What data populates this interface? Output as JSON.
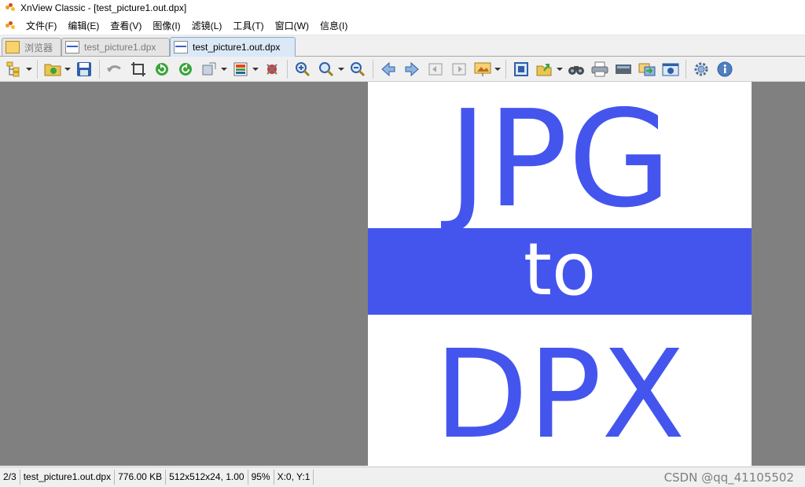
{
  "window": {
    "title": "XnView Classic - [test_picture1.out.dpx]"
  },
  "menu": {
    "items": [
      "文件(F)",
      "编辑(E)",
      "查看(V)",
      "图像(I)",
      "滤镜(L)",
      "工具(T)",
      "窗口(W)",
      "信息(I)"
    ]
  },
  "tabs": [
    {
      "label": "浏览器",
      "active": false
    },
    {
      "label": "test_picture1.dpx",
      "active": false
    },
    {
      "label": "test_picture1.out.dpx",
      "active": true
    }
  ],
  "toolbar": {
    "buttons": [
      "tree-icon",
      "open-folder-icon",
      "save-icon",
      "undo-icon",
      "crop-icon",
      "rotate-left-icon",
      "rotate-right-icon",
      "transform-icon",
      "color-adjust-icon",
      "remove-red-eye-icon",
      "zoom-in-icon",
      "zoom-icon",
      "zoom-out-icon",
      "previous-icon",
      "next-icon",
      "first-page-icon",
      "last-page-icon",
      "slideshow-icon",
      "fullscreen-icon",
      "export-icon",
      "find-icon",
      "print-icon",
      "scan-icon",
      "convert-icon",
      "capture-icon",
      "settings-icon",
      "info-icon"
    ]
  },
  "image": {
    "top_text": "JPG",
    "middle_text": "to",
    "bottom_text": "DPX",
    "accent_color": "#4455ee"
  },
  "status": {
    "position": "2/3",
    "filename": "test_picture1.out.dpx",
    "size": "776.00 KB",
    "dimensions": "512x512x24, 1.00",
    "zoom": "95%",
    "coords": "X:0, Y:1"
  },
  "watermark": "CSDN @qq_41105502"
}
